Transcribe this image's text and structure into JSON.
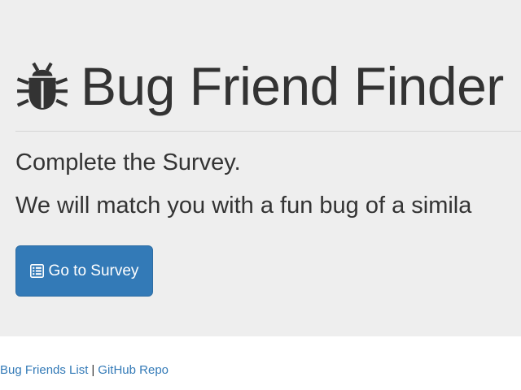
{
  "header": {
    "icon": "bug-icon",
    "title": "Bug Friend Finder"
  },
  "main": {
    "line1": "Complete the Survey.",
    "line2": "We will match you with a fun bug of a simila",
    "button": {
      "icon": "list-alt-icon",
      "label": "Go to Survey"
    }
  },
  "footer": {
    "links": [
      "Bug Friends List",
      "GitHub Repo"
    ],
    "separator": "|"
  },
  "colors": {
    "jumbotron_bg": "#eeeeee",
    "primary": "#337ab7",
    "text": "#333333"
  }
}
